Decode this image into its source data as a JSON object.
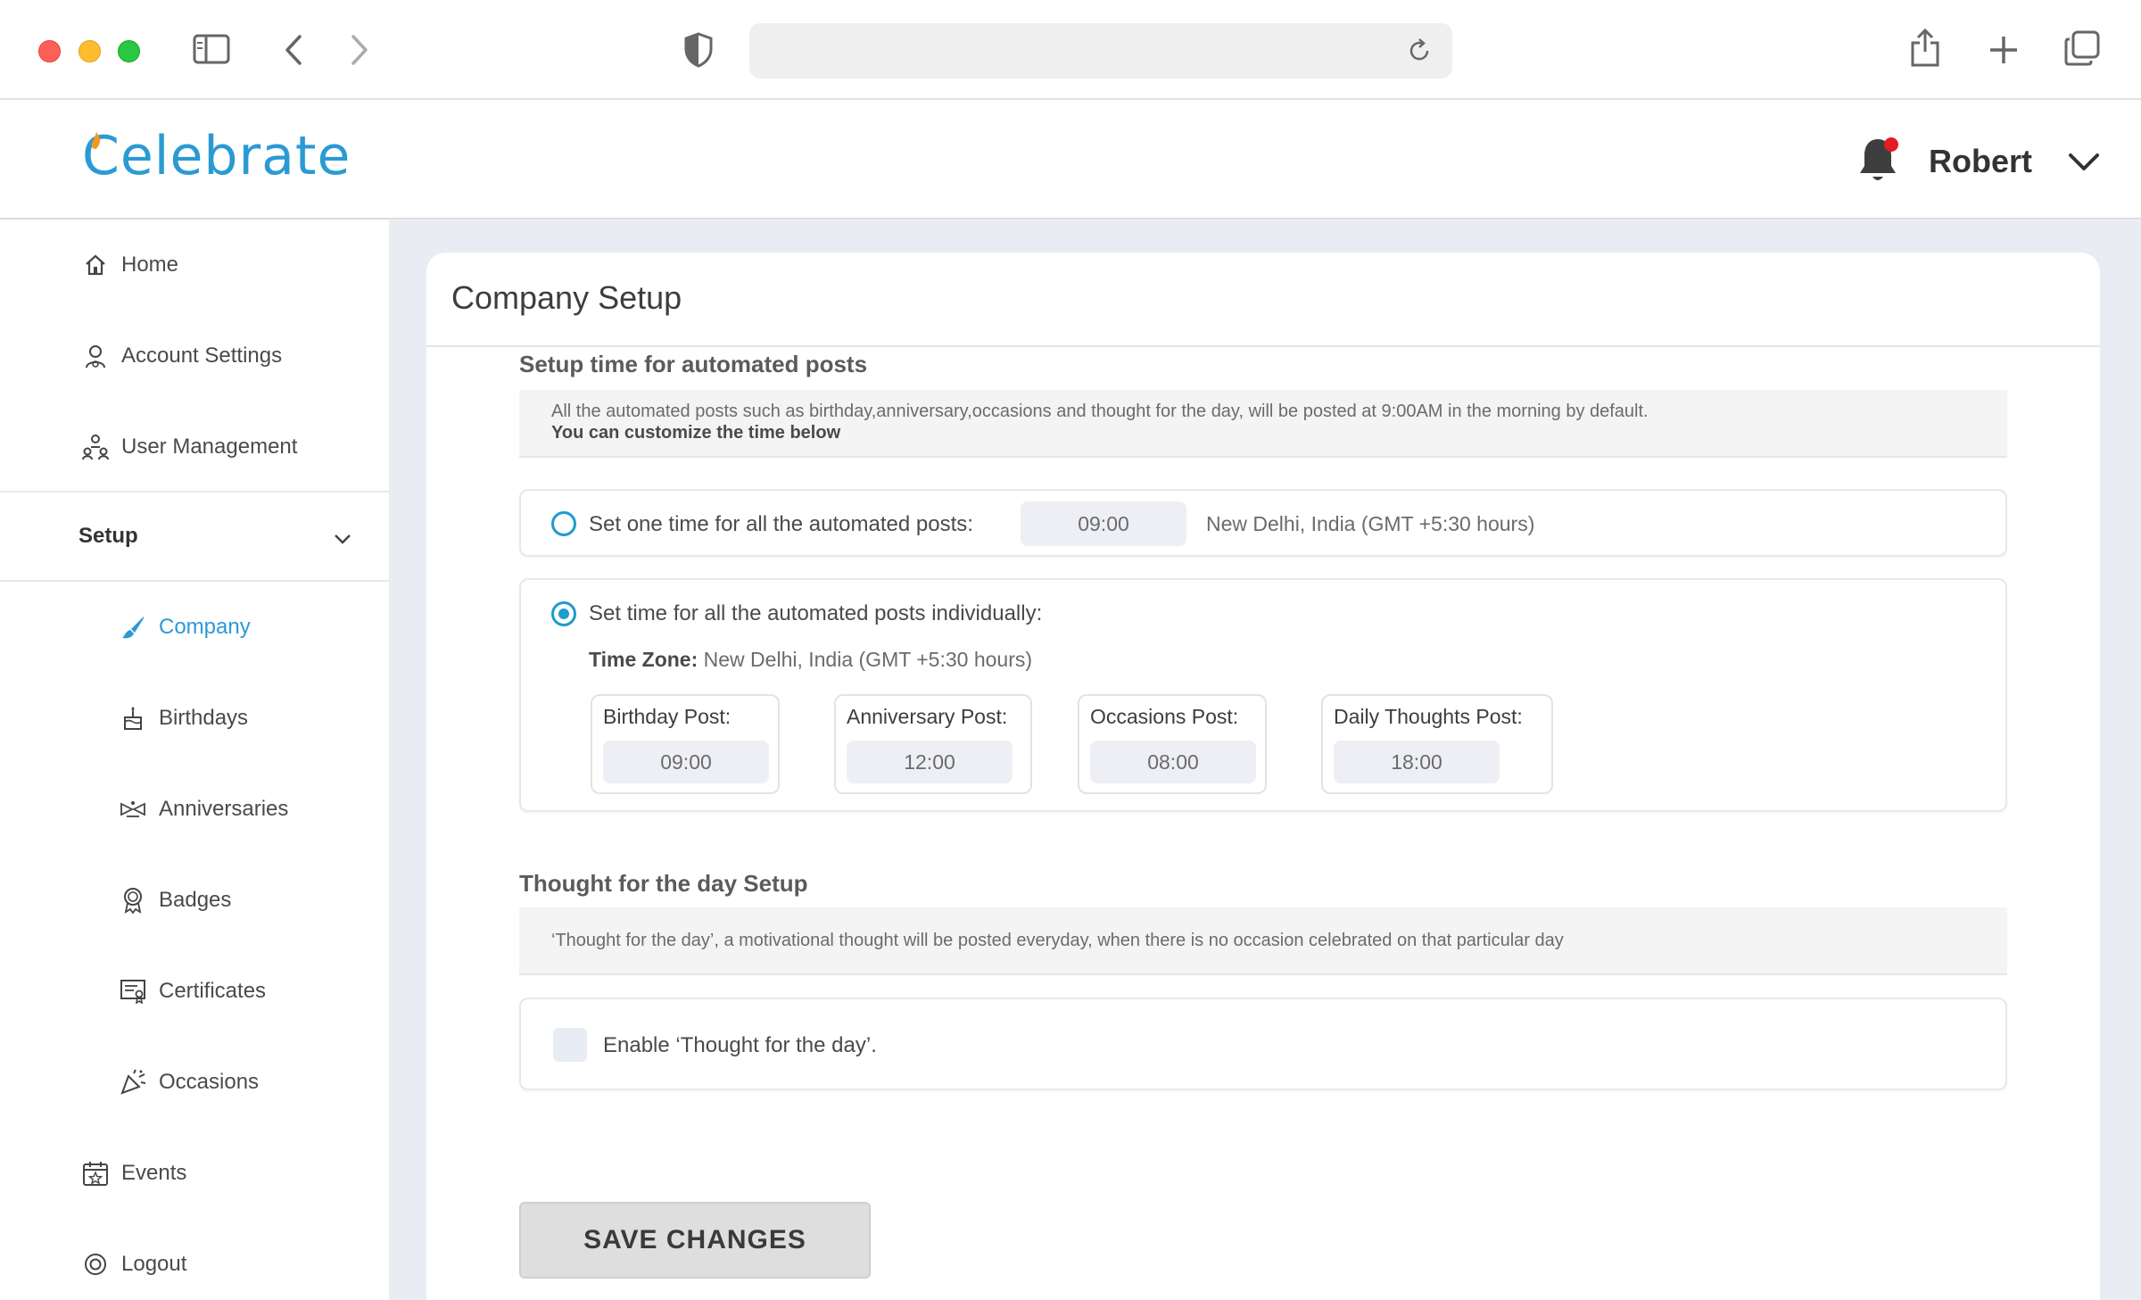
{
  "app": {
    "name": "Celebrate"
  },
  "header": {
    "user_name": "Robert",
    "notification_active": true
  },
  "sidebar": {
    "top_items": [
      {
        "label": "Home",
        "icon": "home-icon"
      },
      {
        "label": "Account Settings",
        "icon": "account-settings-icon"
      },
      {
        "label": "User Management",
        "icon": "user-management-icon"
      }
    ],
    "setup_label": "Setup",
    "setup_items": [
      {
        "label": "Company",
        "icon": "company-brush-icon",
        "active": true
      },
      {
        "label": "Birthdays",
        "icon": "cake-icon"
      },
      {
        "label": "Anniversaries",
        "icon": "anniversary-icon"
      },
      {
        "label": "Badges",
        "icon": "badge-icon"
      },
      {
        "label": "Certificates",
        "icon": "certificate-icon"
      },
      {
        "label": "Occasions",
        "icon": "party-popper-icon"
      }
    ],
    "bottom_items": [
      {
        "label": "Events",
        "icon": "calendar-icon"
      },
      {
        "label": "Logout",
        "icon": "logout-icon"
      }
    ]
  },
  "main": {
    "title": "Company Setup",
    "automated": {
      "section_title": "Setup time for automated posts",
      "info_line1": "All the automated posts such as birthday,anniversary,occasions and thought for the day, will be posted at 9:00AM in the morning by default.",
      "info_line2": "You can customize the time below",
      "option_one": {
        "label": "Set one time for all the automated posts:",
        "time": "09:00",
        "timezone": "New Delhi, India (GMT +5:30 hours)",
        "selected": false
      },
      "option_individual": {
        "label": "Set time for all the automated posts individually:",
        "timezone_label": "Time Zone:",
        "timezone": "New Delhi, India (GMT +5:30 hours)",
        "selected": true,
        "posts": [
          {
            "label": "Birthday Post:",
            "time": "09:00"
          },
          {
            "label": "Anniversary Post:",
            "time": "12:00"
          },
          {
            "label": "Occasions Post:",
            "time": "08:00"
          },
          {
            "label": "Daily Thoughts Post:",
            "time": "18:00"
          }
        ]
      }
    },
    "thought": {
      "section_title": "Thought for the day Setup",
      "info": "‘Thought for the day’, a motivational thought will be posted everyday, when there is no occasion celebrated on that particular day",
      "checkbox_label": "Enable ‘Thought for the day’.",
      "enabled": false
    },
    "save_label": "SAVE CHANGES"
  },
  "colors": {
    "accent": "#2b9ad3",
    "radio": "#1e9bcf",
    "notification": "#e51c23",
    "main_bg": "#e9ecf3"
  }
}
